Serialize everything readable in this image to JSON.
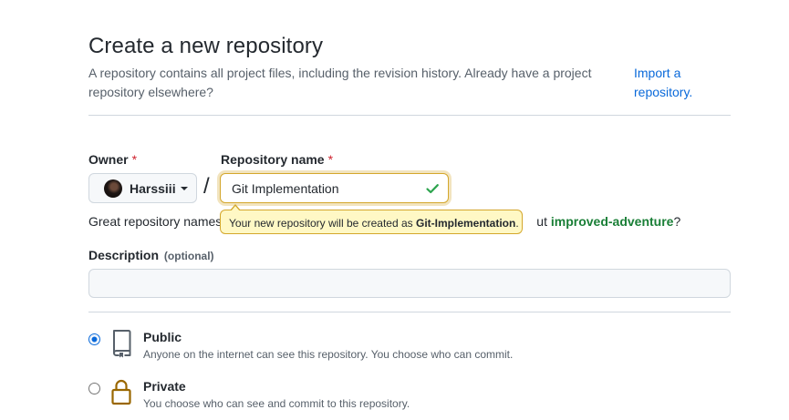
{
  "header": {
    "title": "Create a new repository",
    "subtitle": "A repository contains all project files, including the revision history. Already have a project repository elsewhere?",
    "import_link": "Import a repository."
  },
  "owner": {
    "label": "Owner",
    "required_mark": "*",
    "name": "Harssiii"
  },
  "repo_name": {
    "label": "Repository name",
    "required_mark": "*",
    "value": "Git Implementation",
    "separator": "/"
  },
  "suggestion": {
    "prefix": "Great repository names",
    "suffix_hidden": "ut",
    "suggested_name": "improved-adventure",
    "question_mark": "?"
  },
  "tooltip": {
    "text_prefix": "Your new repository will be created as ",
    "slug": "Git-Implementation",
    "text_suffix": "."
  },
  "description": {
    "label": "Description",
    "optional": "(optional)",
    "value": ""
  },
  "visibility": {
    "public": {
      "title": "Public",
      "desc": "Anyone on the internet can see this repository. You choose who can commit.",
      "selected": true
    },
    "private": {
      "title": "Private",
      "desc": "You choose who can see and commit to this repository.",
      "selected": false
    }
  },
  "colors": {
    "link": "#0969da",
    "success": "#1a7f37",
    "required": "#cf222e",
    "tooltip_bg": "#fff8c5",
    "tooltip_border": "#d4a72c",
    "private_icon": "#9a6700"
  }
}
